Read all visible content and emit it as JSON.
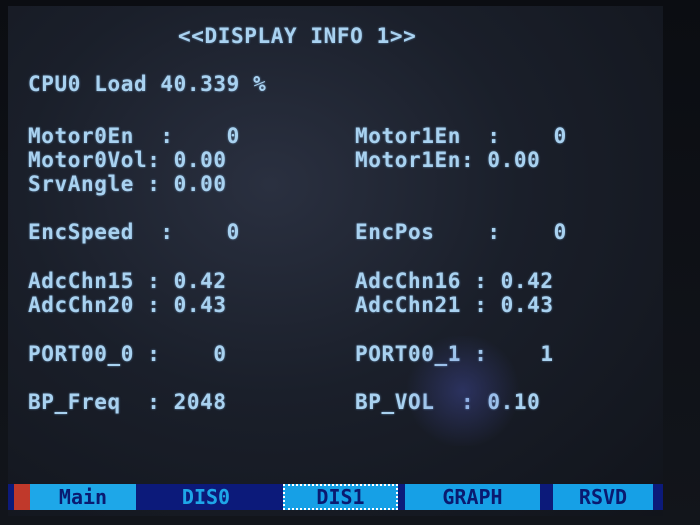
{
  "title": "<<DISPLAY INFO 1>>",
  "cpu_load": "CPU0 Load 40.339 %",
  "rows": [
    {
      "left": "Motor0En  :    0",
      "right": "Motor1En  :    0"
    },
    {
      "left": "Motor0Vol: 0.00",
      "right": "Motor1En: 0.00"
    },
    {
      "left": "SrvAngle : 0.00",
      "right": ""
    },
    {
      "left": "EncSpeed  :    0",
      "right": "EncPos    :    0"
    },
    {
      "left": "AdcChn15 : 0.42",
      "right": "AdcChn16 : 0.42"
    },
    {
      "left": "AdcChn20 : 0.43",
      "right": "AdcChn21 : 0.43"
    },
    {
      "left": "PORT00_0 :    0",
      "right": "PORT00_1 :    1"
    },
    {
      "left": "BP_Freq  : 2048",
      "right": "BP_VOL  : 0.10"
    }
  ],
  "tabs": [
    {
      "label": "Main"
    },
    {
      "label": "DIS0"
    },
    {
      "label": "DIS1"
    },
    {
      "label": "GRAPH"
    },
    {
      "label": "RSVD"
    }
  ],
  "colors": {
    "text": "#a9d2f0",
    "tab_bar": "#0c1a7a",
    "tab_active": "#16a0e6",
    "accent_red": "#c0392b"
  }
}
